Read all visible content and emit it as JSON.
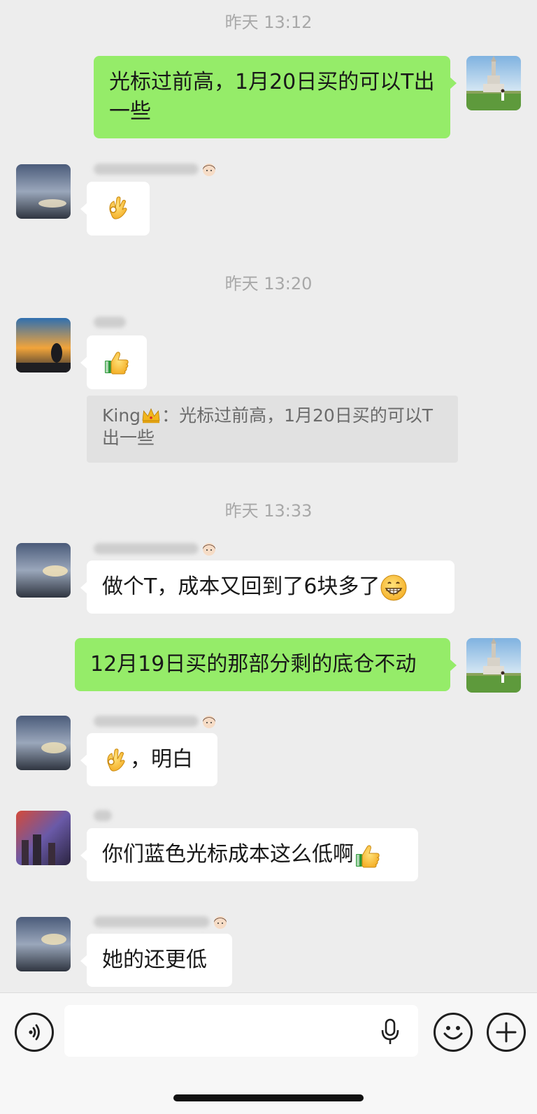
{
  "timestamps": {
    "t1": "昨天 13:12",
    "t2": "昨天 13:20",
    "t3": "昨天 13:33"
  },
  "messages": {
    "m1": {
      "side": "out",
      "text": "光标过前高，1月20日买的可以T出一些"
    },
    "m2": {
      "side": "in",
      "emoji": "ok-hand"
    },
    "m3": {
      "side": "in",
      "emoji": "thumbs-up"
    },
    "quote": {
      "author": "King",
      "author_emoji": "crown",
      "text": "：光标过前高，1月20日买的可以T出一些"
    },
    "m4": {
      "side": "in",
      "text": "做个T，成本又回到了6块多了",
      "emoji": "grinning-face"
    },
    "m5": {
      "side": "out",
      "text": "12月19日买的那部分剩的底仓不动"
    },
    "m6": {
      "side": "in",
      "emoji": "ok-hand",
      "text": "，明白"
    },
    "m7": {
      "side": "in",
      "text": "你们蓝色光标成本这么低啊",
      "emoji": "thumbs-up"
    },
    "m8": {
      "side": "in",
      "text": "她的还更低"
    }
  },
  "input_bar": {
    "icons": [
      "voice-icon",
      "microphone-icon",
      "emoji-icon",
      "plus-icon"
    ],
    "message_value": ""
  },
  "colors": {
    "background": "#ededed",
    "outgoing_bubble": "#95ec69",
    "incoming_bubble": "#ffffff",
    "timestamp_text": "#a8a8a8"
  }
}
